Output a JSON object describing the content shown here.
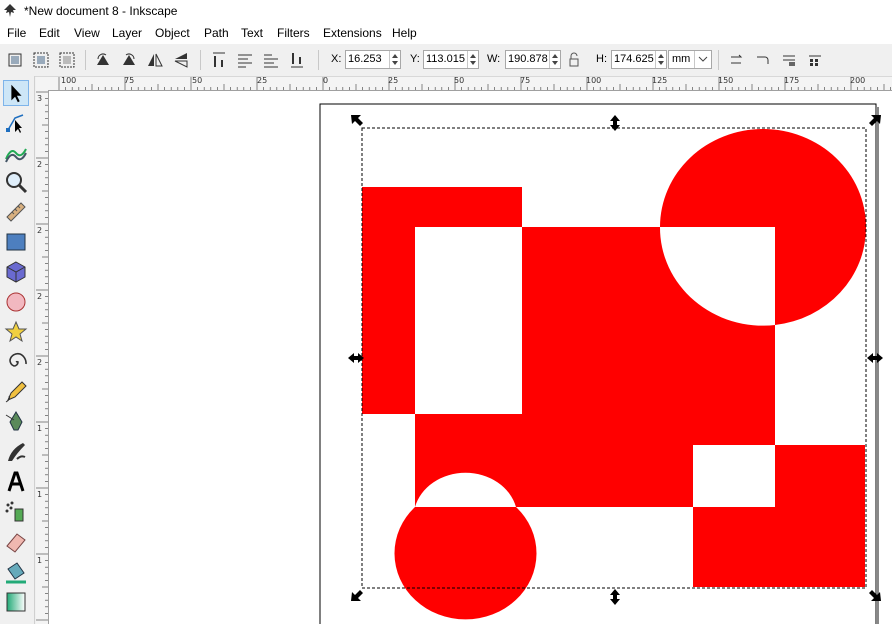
{
  "window": {
    "title": "*New document 8 - Inkscape"
  },
  "menu": [
    "File",
    "Edit",
    "View",
    "Layer",
    "Object",
    "Path",
    "Text",
    "Filters",
    "Extensions",
    "Help"
  ],
  "toolbar": {
    "x_label": "X:",
    "x_value": "16.253",
    "y_label": "Y:",
    "y_value": "113.015",
    "w_label": "W:",
    "w_value": "190.878",
    "h_label": "H:",
    "h_value": "174.625",
    "unit": "mm"
  },
  "ruler": {
    "h_labels": [
      "100",
      "75",
      "50",
      "25",
      "0",
      "25",
      "50",
      "75",
      "100",
      "125",
      "150",
      "175",
      "200"
    ],
    "v_labels": [
      "3",
      "2",
      "2",
      "2",
      "2",
      "1",
      "1",
      "1"
    ]
  },
  "colors": {
    "shape_fill": "#ff0000",
    "accent": "#1e6ebf"
  },
  "tools": [
    "selector-icon",
    "node-icon",
    "tweak-icon",
    "zoom-icon",
    "measure-icon",
    "rectangle-icon",
    "3d-box-icon",
    "ellipse-icon",
    "star-icon",
    "spiral-icon",
    "pencil-icon",
    "pen-icon",
    "calligraphy-icon",
    "text-icon",
    "spray-icon",
    "eraser-icon",
    "paint-bucket-icon",
    "gradient-icon"
  ]
}
